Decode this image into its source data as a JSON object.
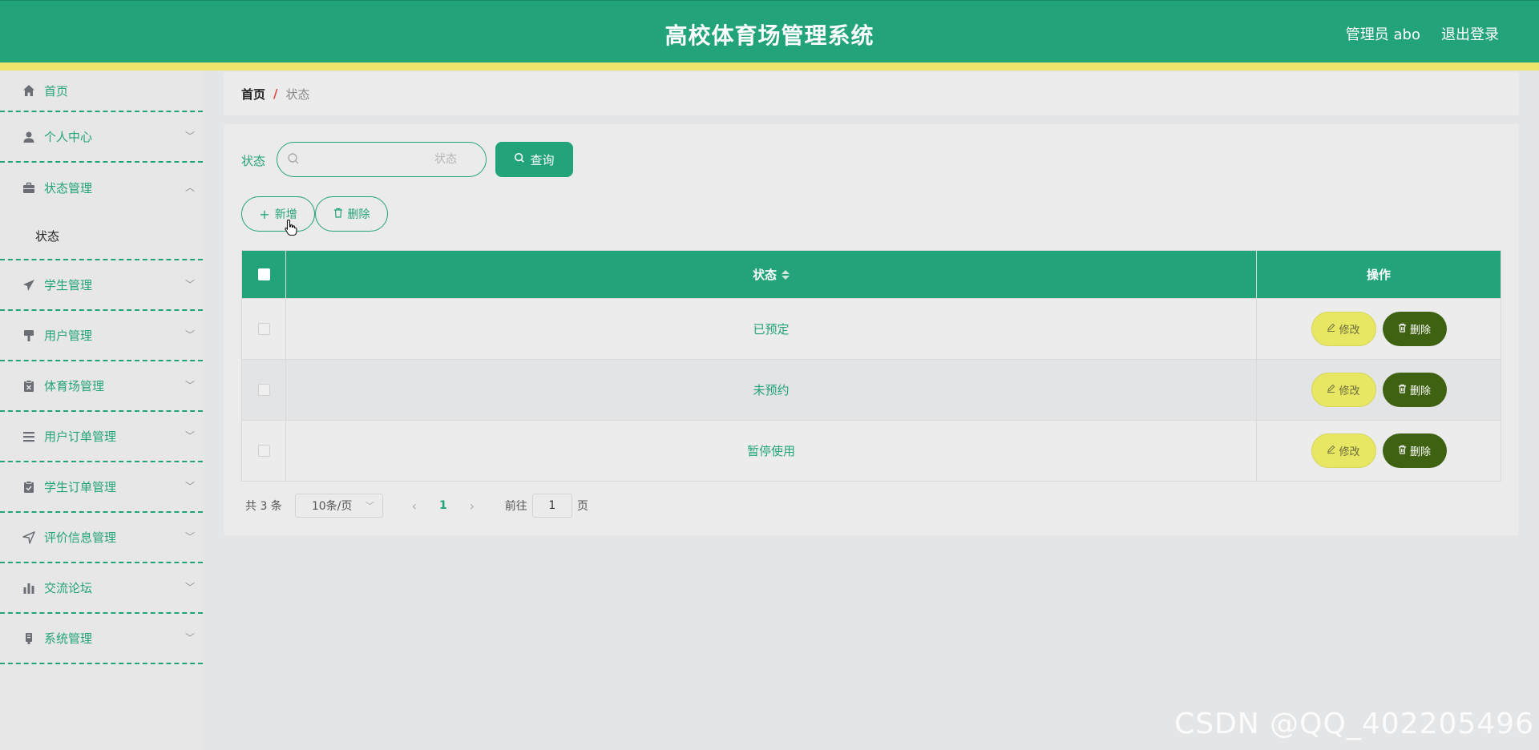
{
  "header": {
    "title": "高校体育场管理系统",
    "user": "管理员 abo",
    "logout": "退出登录"
  },
  "sidebar": {
    "items": [
      {
        "label": "首页",
        "icon": "home-icon"
      },
      {
        "label": "个人中心",
        "icon": "user-icon"
      },
      {
        "label": "状态管理",
        "icon": "briefcase-icon",
        "submenu": [
          "状态"
        ]
      },
      {
        "label": "学生管理",
        "icon": "send-icon"
      },
      {
        "label": "用户管理",
        "icon": "brush-icon"
      },
      {
        "label": "体育场管理",
        "icon": "clipboard-x-icon"
      },
      {
        "label": "用户订单管理",
        "icon": "list-icon"
      },
      {
        "label": "学生订单管理",
        "icon": "clipboard-check-icon"
      },
      {
        "label": "评价信息管理",
        "icon": "navigation-icon"
      },
      {
        "label": "交流论坛",
        "icon": "bar-chart-icon"
      },
      {
        "label": "系统管理",
        "icon": "device-icon"
      }
    ]
  },
  "breadcrumb": {
    "home": "首页",
    "separator": "/",
    "current": "状态"
  },
  "search": {
    "label": "状态",
    "placeholder": "状态",
    "query_label": "查询"
  },
  "toolbar": {
    "add_label": "新增",
    "delete_label": "删除"
  },
  "table": {
    "columns": [
      "状态",
      "操作"
    ],
    "rows": [
      "已预定",
      "未预约",
      "暂停使用"
    ],
    "edit_label": "修改",
    "delete_label": "删除"
  },
  "pagination": {
    "total": "共 3 条",
    "page_size": "10条/页",
    "current_page": "1",
    "goto_label": "前往",
    "goto_value": "1",
    "page_unit": "页"
  },
  "watermark": "CSDN @QQ_402205496",
  "colors": {
    "primary": "#23a37a",
    "accent_yellow": "#ede46c",
    "edit_button": "#e7e764",
    "delete_button": "#3f6212"
  }
}
